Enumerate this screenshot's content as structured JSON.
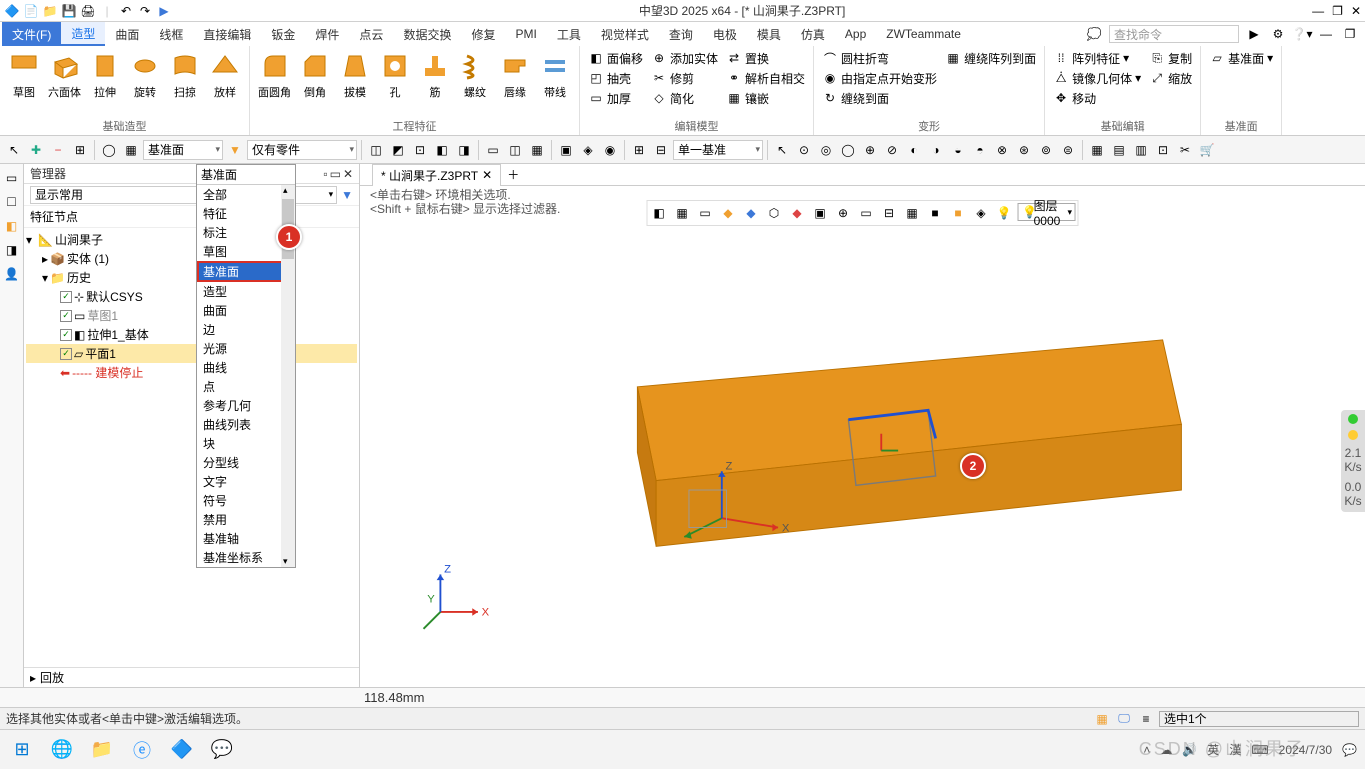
{
  "app": {
    "title": "中望3D 2025 x64 - [* 山涧果子.Z3PRT]"
  },
  "menu": {
    "file": "文件(F)",
    "tabs": [
      "造型",
      "曲面",
      "线框",
      "直接编辑",
      "钣金",
      "焊件",
      "点云",
      "数据交换",
      "修复",
      "PMI",
      "工具",
      "视觉样式",
      "查询",
      "电极",
      "模具",
      "仿真",
      "App",
      "ZWTeammate"
    ],
    "search_ph": "查找命令"
  },
  "ribbon": {
    "g1": {
      "label": "基础造型",
      "btns": [
        "草图",
        "六面体",
        "拉伸",
        "旋转",
        "扫掠",
        "放样"
      ]
    },
    "g2": {
      "label": "工程特征",
      "btns": [
        "面圆角",
        "倒角",
        "拔模",
        "孔",
        "筋",
        "螺纹",
        "唇缘",
        "带线"
      ]
    },
    "g3": {
      "label": "编辑模型",
      "col1": [
        "面偏移",
        "抽壳",
        "加厚"
      ],
      "col2": [
        "添加实体",
        "修剪",
        "简化"
      ],
      "col3": [
        "置换",
        "解析自相交",
        "镶嵌"
      ]
    },
    "g4": {
      "label": "变形",
      "items": [
        "圆柱折弯",
        "由指定点开始变形",
        "缠绕到面"
      ],
      "extra": "缠绕阵列到面"
    },
    "g5": {
      "label": "基础编辑",
      "col1": [
        "阵列特征",
        "镜像几何体",
        "移动"
      ],
      "col2": [
        "复制",
        "缩放"
      ]
    },
    "g6": {
      "label": "基准面",
      "btn": "基准面"
    }
  },
  "filterbar": {
    "combo1": "基准面",
    "combo2": "仅有零件",
    "combo3": "单一基准"
  },
  "manager": {
    "title": "管理器",
    "display": "显示常用",
    "node_label": "特征节点",
    "tree": {
      "root": "山涧果子",
      "solid": "实体 (1)",
      "history": "历史",
      "csys": "默认CSYS",
      "sketch": "草图1",
      "extrude": "拉伸1_基体",
      "plane": "平面1",
      "stop": "----- 建模停止"
    },
    "footer": "回放"
  },
  "filter_dd": {
    "selected": "基准面",
    "items_top": [
      "全部",
      "特征",
      "标注",
      "草图"
    ],
    "highlight": "基准面",
    "items_bot": [
      "造型",
      "曲面",
      "边",
      "光源",
      "曲线",
      "点",
      "参考几何",
      "曲线列表",
      "块",
      "分型线",
      "文字",
      "符号",
      "禁用",
      "基准轴",
      "基准坐标系"
    ]
  },
  "callouts": {
    "one": "1",
    "two": "2"
  },
  "viewport": {
    "tab": "* 山涧果子.Z3PRT",
    "hint1": "<单击右键> 环境相关选项.",
    "hint2": "<Shift + 鼠标右键> 显示选择过滤器.",
    "layer": "图层0000",
    "axes": {
      "x": "X",
      "y": "Y",
      "z": "Z"
    }
  },
  "coord": "118.48mm",
  "status": {
    "prompt": "选择其他实体或者<单击中键>激活编辑选项。",
    "selection": "选中1个"
  },
  "perf": {
    "v1": "2.1",
    "u1": "K/s",
    "v2": "0.0",
    "u2": "K/s"
  },
  "taskbar": {
    "lang1": "英",
    "lang2": "漢",
    "date": "2024/7/30",
    "watermark": "CSDN @山涧果子"
  }
}
